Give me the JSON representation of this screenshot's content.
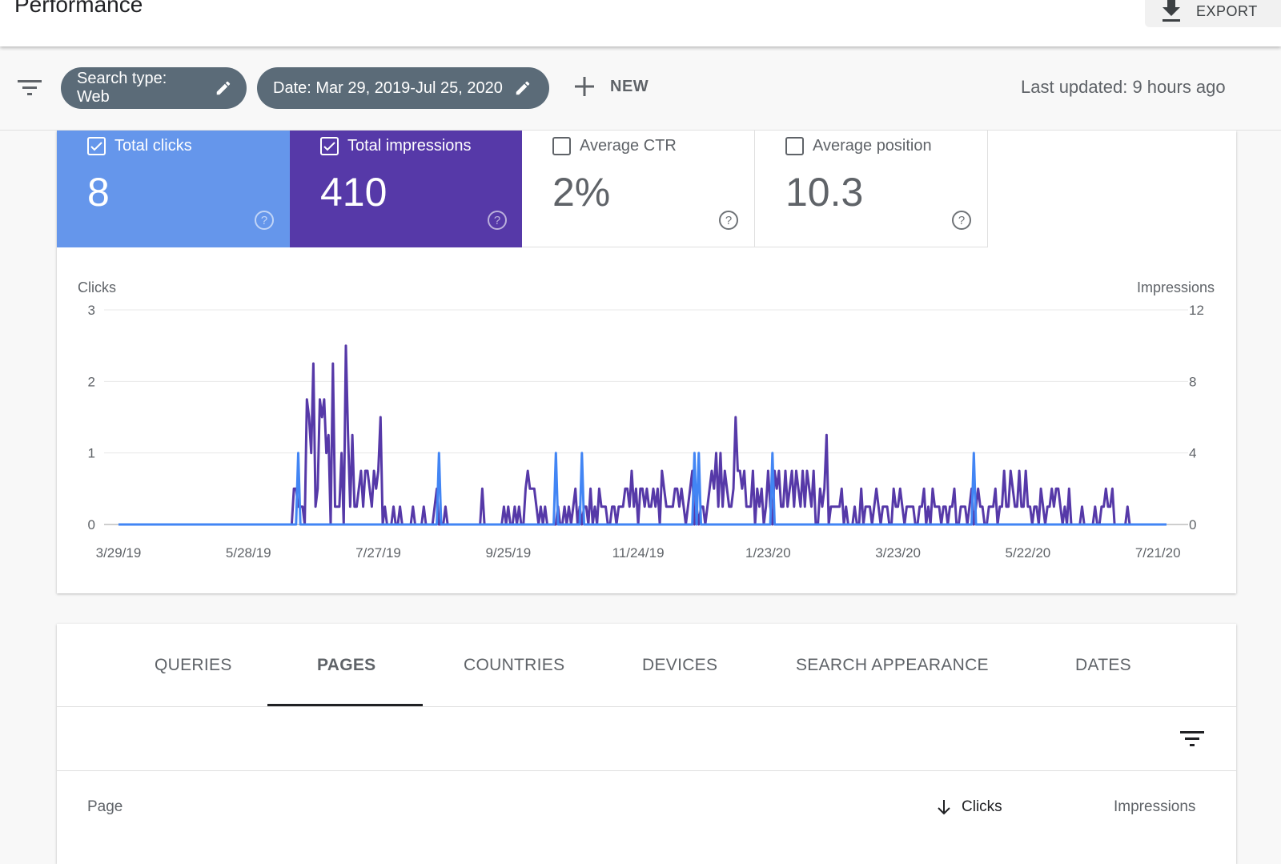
{
  "header": {
    "title": "Performance",
    "export_label": "EXPORT",
    "export_icon": "download-icon"
  },
  "filters": {
    "filter_icon": "filter-list-icon",
    "chips": [
      {
        "label": "Search type: Web",
        "icon": "edit-pencil-icon"
      },
      {
        "label": "Date: Mar 29, 2019-Jul 25, 2020",
        "icon": "edit-pencil-icon"
      }
    ],
    "new_label": "NEW",
    "new_icon": "plus-icon",
    "last_updated": "Last updated: 9 hours ago"
  },
  "metrics": [
    {
      "label": "Total clicks",
      "value": "8",
      "checked": true,
      "color": "#6596eb"
    },
    {
      "label": "Total impressions",
      "value": "410",
      "checked": true,
      "color": "#5639a8"
    },
    {
      "label": "Average CTR",
      "value": "2%",
      "checked": false
    },
    {
      "label": "Average position",
      "value": "10.3",
      "checked": false
    }
  ],
  "chart_data": {
    "type": "line",
    "y_left_label": "Clicks",
    "y_right_label": "Impressions",
    "y_left_ticks": [
      "0",
      "1",
      "2",
      "3"
    ],
    "y_right_ticks": [
      "0",
      "4",
      "8",
      "12"
    ],
    "y_left_range": [
      0,
      3
    ],
    "y_right_range": [
      0,
      12
    ],
    "x_tick_labels": [
      "3/29/19",
      "5/28/19",
      "7/27/19",
      "9/25/19",
      "11/24/19",
      "1/23/20",
      "3/23/20",
      "5/22/20",
      "7/21/20"
    ],
    "x_start": "3/29/19",
    "x_end": "7/25/20",
    "total_days": 485,
    "x_tick_interval_days": 60,
    "grid": true,
    "series": [
      {
        "name": "Clicks",
        "axis": "left",
        "color": "#4285f4",
        "nonzero_points": [
          [
            83,
            1
          ],
          [
            148,
            1
          ],
          [
            202,
            1
          ],
          [
            214,
            1
          ],
          [
            266,
            1
          ],
          [
            268,
            1
          ],
          [
            302,
            1
          ],
          [
            395,
            1
          ]
        ]
      },
      {
        "name": "Impressions",
        "axis": "right",
        "color": "#5639a8",
        "nonzero_points": [
          [
            81,
            2
          ],
          [
            82,
            2
          ],
          [
            83,
            1
          ],
          [
            84,
            1
          ],
          [
            85,
            1
          ],
          [
            87,
            7
          ],
          [
            88,
            6
          ],
          [
            89,
            4
          ],
          [
            90,
            9
          ],
          [
            91,
            1
          ],
          [
            92,
            2
          ],
          [
            93,
            7
          ],
          [
            94,
            6
          ],
          [
            95,
            7
          ],
          [
            96,
            4
          ],
          [
            97,
            5
          ],
          [
            99,
            9
          ],
          [
            100,
            1
          ],
          [
            101,
            1
          ],
          [
            102,
            1
          ],
          [
            103,
            4
          ],
          [
            105,
            10
          ],
          [
            106,
            5
          ],
          [
            107,
            1
          ],
          [
            108,
            5
          ],
          [
            109,
            1
          ],
          [
            110,
            1
          ],
          [
            111,
            2
          ],
          [
            112,
            3
          ],
          [
            113,
            1
          ],
          [
            114,
            3
          ],
          [
            115,
            3
          ],
          [
            116,
            2
          ],
          [
            117,
            1
          ],
          [
            118,
            3
          ],
          [
            119,
            2
          ],
          [
            120,
            3
          ],
          [
            121,
            6
          ],
          [
            123,
            1
          ],
          [
            127,
            1
          ],
          [
            130,
            1
          ],
          [
            136,
            1
          ],
          [
            141,
            1
          ],
          [
            146,
            1
          ],
          [
            147,
            2
          ],
          [
            151,
            1
          ],
          [
            168,
            2
          ],
          [
            178,
            1
          ],
          [
            180,
            1
          ],
          [
            183,
            1
          ],
          [
            185,
            1
          ],
          [
            188,
            2
          ],
          [
            189,
            3
          ],
          [
            190,
            2
          ],
          [
            191,
            2
          ],
          [
            192,
            2
          ],
          [
            193,
            1
          ],
          [
            195,
            1
          ],
          [
            197,
            1
          ],
          [
            203,
            1
          ],
          [
            206,
            1
          ],
          [
            208,
            1
          ],
          [
            210,
            1
          ],
          [
            211,
            2
          ],
          [
            213,
            1
          ],
          [
            215,
            1
          ],
          [
            216,
            1
          ],
          [
            218,
            2
          ],
          [
            220,
            1
          ],
          [
            222,
            2
          ],
          [
            223,
            1
          ],
          [
            224,
            1
          ],
          [
            225,
            1
          ],
          [
            228,
            1
          ],
          [
            229,
            1
          ],
          [
            231,
            1
          ],
          [
            232,
            1
          ],
          [
            233,
            1
          ],
          [
            234,
            2
          ],
          [
            235,
            2
          ],
          [
            236,
            1
          ],
          [
            237,
            3
          ],
          [
            238,
            1
          ],
          [
            239,
            2
          ],
          [
            241,
            2
          ],
          [
            242,
            2
          ],
          [
            243,
            1
          ],
          [
            244,
            2
          ],
          [
            245,
            1
          ],
          [
            246,
            1
          ],
          [
            247,
            2
          ],
          [
            248,
            1
          ],
          [
            249,
            2
          ],
          [
            251,
            3
          ],
          [
            252,
            2
          ],
          [
            253,
            1
          ],
          [
            254,
            1
          ],
          [
            255,
            1
          ],
          [
            256,
            1
          ],
          [
            257,
            2
          ],
          [
            258,
            2
          ],
          [
            259,
            1
          ],
          [
            260,
            2
          ],
          [
            261,
            1
          ],
          [
            263,
            1
          ],
          [
            264,
            2
          ],
          [
            265,
            3
          ],
          [
            267,
            1
          ],
          [
            269,
            1
          ],
          [
            270,
            1
          ],
          [
            272,
            1
          ],
          [
            273,
            2
          ],
          [
            274,
            3
          ],
          [
            275,
            2
          ],
          [
            276,
            4
          ],
          [
            277,
            1
          ],
          [
            278,
            4
          ],
          [
            279,
            1
          ],
          [
            280,
            3
          ],
          [
            281,
            2
          ],
          [
            282,
            1
          ],
          [
            283,
            1
          ],
          [
            284,
            2
          ],
          [
            285,
            6
          ],
          [
            286,
            3
          ],
          [
            287,
            3
          ],
          [
            288,
            2
          ],
          [
            289,
            3
          ],
          [
            290,
            1
          ],
          [
            291,
            1
          ],
          [
            292,
            1
          ],
          [
            293,
            3
          ],
          [
            295,
            2
          ],
          [
            296,
            1
          ],
          [
            297,
            2
          ],
          [
            299,
            1
          ],
          [
            300,
            3
          ],
          [
            301,
            1
          ],
          [
            303,
            3
          ],
          [
            304,
            2
          ],
          [
            305,
            3
          ],
          [
            306,
            1
          ],
          [
            307,
            1
          ],
          [
            308,
            3
          ],
          [
            309,
            1
          ],
          [
            310,
            2
          ],
          [
            311,
            3
          ],
          [
            312,
            1
          ],
          [
            313,
            3
          ],
          [
            314,
            2
          ],
          [
            315,
            1
          ],
          [
            316,
            3
          ],
          [
            317,
            1
          ],
          [
            318,
            3
          ],
          [
            319,
            2
          ],
          [
            320,
            1
          ],
          [
            321,
            3
          ],
          [
            324,
            2
          ],
          [
            325,
            1
          ],
          [
            326,
            2
          ],
          [
            327,
            5
          ],
          [
            329,
            1
          ],
          [
            330,
            1
          ],
          [
            331,
            1
          ],
          [
            332,
            1
          ],
          [
            333,
            1
          ],
          [
            334,
            2
          ],
          [
            336,
            1
          ],
          [
            340,
            1
          ],
          [
            343,
            2
          ],
          [
            345,
            1
          ],
          [
            346,
            1
          ],
          [
            347,
            1
          ],
          [
            349,
            1
          ],
          [
            350,
            2
          ],
          [
            351,
            1
          ],
          [
            353,
            1
          ],
          [
            354,
            1
          ],
          [
            355,
            1
          ],
          [
            358,
            2
          ],
          [
            359,
            1
          ],
          [
            360,
            1
          ],
          [
            361,
            2
          ],
          [
            362,
            1
          ],
          [
            364,
            1
          ],
          [
            365,
            1
          ],
          [
            366,
            1
          ],
          [
            367,
            1
          ],
          [
            370,
            1
          ],
          [
            371,
            1
          ],
          [
            372,
            2
          ],
          [
            374,
            1
          ],
          [
            376,
            2
          ],
          [
            377,
            1
          ],
          [
            378,
            1
          ],
          [
            379,
            1
          ],
          [
            381,
            1
          ],
          [
            382,
            1
          ],
          [
            384,
            1
          ],
          [
            385,
            1
          ],
          [
            386,
            2
          ],
          [
            389,
            1
          ],
          [
            390,
            1
          ],
          [
            391,
            1
          ],
          [
            393,
            1
          ],
          [
            394,
            2
          ],
          [
            396,
            1
          ],
          [
            397,
            2
          ],
          [
            398,
            1
          ],
          [
            399,
            1
          ],
          [
            402,
            1
          ],
          [
            403,
            1
          ],
          [
            404,
            1
          ],
          [
            405,
            2
          ],
          [
            407,
            1
          ],
          [
            408,
            1
          ],
          [
            409,
            3
          ],
          [
            410,
            1
          ],
          [
            411,
            1
          ],
          [
            412,
            3
          ],
          [
            413,
            2
          ],
          [
            414,
            1
          ],
          [
            415,
            1
          ],
          [
            416,
            3
          ],
          [
            417,
            1
          ],
          [
            418,
            1
          ],
          [
            419,
            3
          ],
          [
            420,
            1
          ],
          [
            421,
            1
          ],
          [
            423,
            1
          ],
          [
            424,
            1
          ],
          [
            426,
            2
          ],
          [
            427,
            1
          ],
          [
            429,
            1
          ],
          [
            430,
            1
          ],
          [
            431,
            2
          ],
          [
            432,
            1
          ],
          [
            433,
            2
          ],
          [
            434,
            2
          ],
          [
            435,
            1
          ],
          [
            437,
            1
          ],
          [
            439,
            2
          ],
          [
            445,
            1
          ],
          [
            451,
            1
          ],
          [
            454,
            1
          ],
          [
            455,
            1
          ],
          [
            456,
            2
          ],
          [
            457,
            1
          ],
          [
            458,
            1
          ],
          [
            459,
            2
          ],
          [
            466,
            1
          ]
        ]
      }
    ]
  },
  "table_card": {
    "tabs": [
      {
        "label": "QUERIES",
        "active": false
      },
      {
        "label": "PAGES",
        "active": true
      },
      {
        "label": "COUNTRIES",
        "active": false
      },
      {
        "label": "DEVICES",
        "active": false
      },
      {
        "label": "SEARCH APPEARANCE",
        "active": false
      },
      {
        "label": "DATES",
        "active": false
      }
    ],
    "filter_icon": "filter-list-icon",
    "columns": [
      {
        "label": "Page"
      },
      {
        "label": "Clicks",
        "sorted": "descending"
      },
      {
        "label": "Impressions"
      }
    ]
  }
}
